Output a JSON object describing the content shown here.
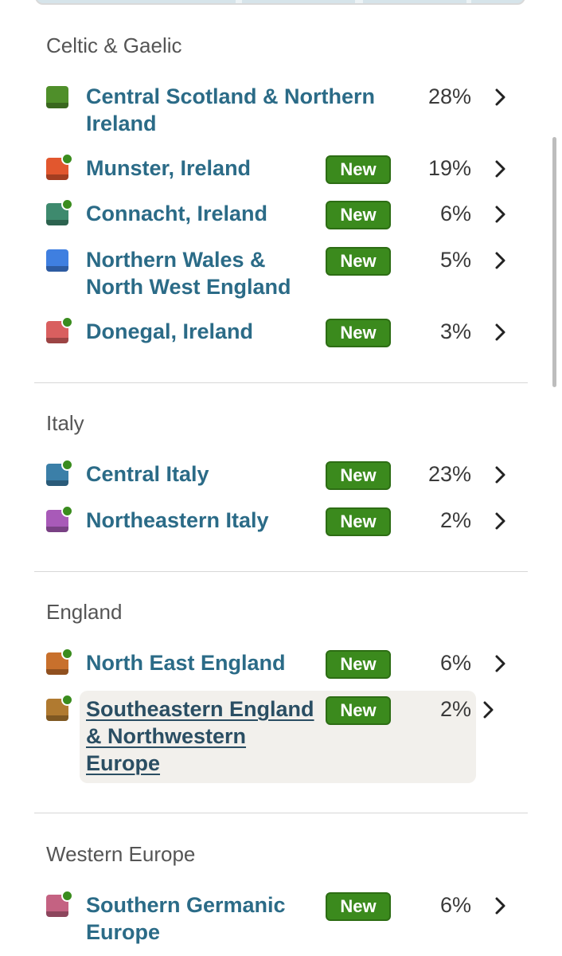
{
  "colors": {
    "region_link": "#2b6b87",
    "badge_green": "#3b8a1d",
    "new_dot": "#3a8c1e"
  },
  "groups": [
    {
      "title": "Celtic & Gaelic",
      "regions": [
        {
          "name": "Central Scotland & Northern Ireland",
          "percent": "28%",
          "color": "#4f8f2a",
          "is_new": false
        },
        {
          "name": "Munster, Ireland",
          "badge": "New",
          "percent": "19%",
          "color": "#e2572e",
          "is_new": true
        },
        {
          "name": "Connacht, Ireland",
          "badge": "New",
          "percent": "6%",
          "color": "#3e8a6e",
          "is_new": true
        },
        {
          "name": "Northern Wales & North West England",
          "badge": "New",
          "percent": "5%",
          "color": "#3f7fe0",
          "is_new": false
        },
        {
          "name": "Donegal, Ireland",
          "badge": "New",
          "percent": "3%",
          "color": "#d95f5f",
          "is_new": true
        }
      ]
    },
    {
      "title": "Italy",
      "regions": [
        {
          "name": "Central Italy",
          "badge": "New",
          "percent": "23%",
          "color": "#3b7fa8",
          "is_new": true
        },
        {
          "name": "Northeastern Italy",
          "badge": "New",
          "percent": "2%",
          "color": "#a85ab8",
          "is_new": true
        }
      ]
    },
    {
      "title": "England",
      "regions": [
        {
          "name": "North East England",
          "badge": "New",
          "percent": "6%",
          "color": "#c8702c",
          "is_new": true
        },
        {
          "name": "Southeastern England & Northwestern Europe",
          "badge": "New",
          "percent": "2%",
          "color": "#b07a30",
          "is_new": true
        }
      ]
    },
    {
      "title": "Western Europe",
      "regions": [
        {
          "name": "Southern Germanic Europe",
          "badge": "New",
          "percent": "6%",
          "color": "#c46282",
          "is_new": true
        }
      ]
    }
  ]
}
